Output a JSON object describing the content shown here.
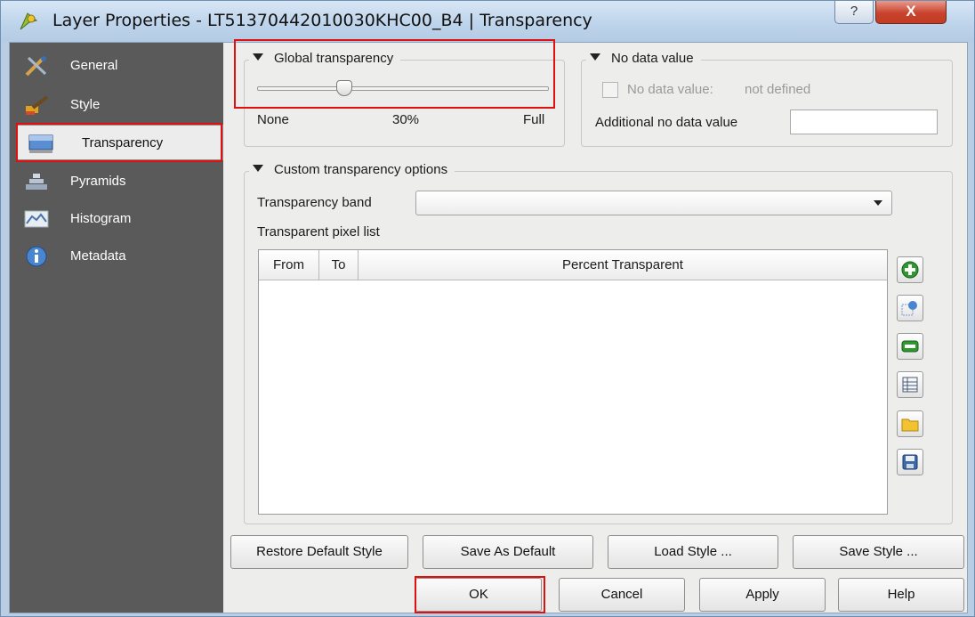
{
  "window": {
    "title": "Layer Properties - LT51370442010030KHC00_B4 | Transparency",
    "help_glyph": "?",
    "close_glyph": "X"
  },
  "sidebar": {
    "items": [
      {
        "label": "General",
        "icon": "general-tools-icon"
      },
      {
        "label": "Style",
        "icon": "style-brush-icon"
      },
      {
        "label": "Transparency",
        "icon": "transparency-icon",
        "active": true
      },
      {
        "label": "Pyramids",
        "icon": "pyramids-icon"
      },
      {
        "label": "Histogram",
        "icon": "histogram-icon"
      },
      {
        "label": "Metadata",
        "icon": "metadata-info-icon"
      }
    ]
  },
  "global_transparency": {
    "title": "Global transparency",
    "min_label": "None",
    "value_label": "30%",
    "max_label": "Full",
    "value_fraction": 0.3
  },
  "no_data": {
    "title": "No data value",
    "checkbox_label": "No data value:",
    "checkbox_value": "not defined",
    "additional_label": "Additional no data value",
    "additional_value": ""
  },
  "custom": {
    "title": "Custom transparency options",
    "band_label": "Transparency band",
    "band_value": "",
    "pixel_list_label": "Transparent pixel list",
    "columns": [
      "From",
      "To",
      "Percent Transparent"
    ]
  },
  "side_buttons": [
    "add-row-icon",
    "pick-values-icon",
    "remove-row-icon",
    "default-values-icon",
    "import-folder-icon",
    "export-save-icon"
  ],
  "style_buttons": {
    "restore": "Restore Default Style",
    "save_default": "Save As Default",
    "load": "Load Style ...",
    "save": "Save Style ..."
  },
  "dialog_buttons": {
    "ok": "OK",
    "cancel": "Cancel",
    "apply": "Apply",
    "help": "Help"
  },
  "colors": {
    "highlight": "#e01010",
    "sidebar": "#5a5a5a",
    "add_green": "#2e9a2e",
    "folder_yellow": "#f2c230"
  }
}
